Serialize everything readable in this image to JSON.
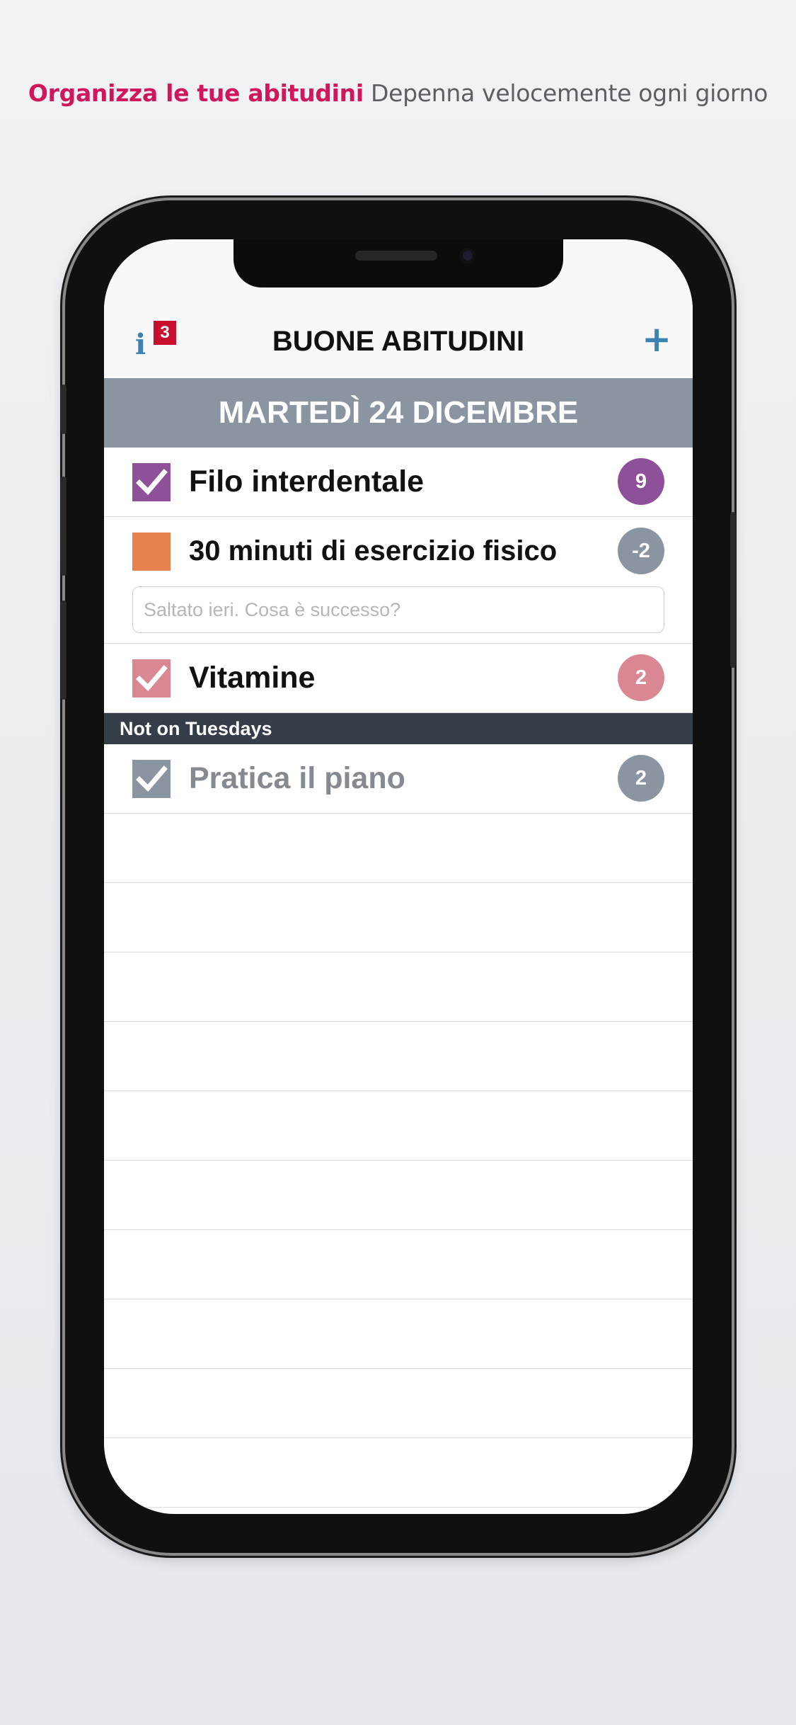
{
  "headline": {
    "accent": "Organizza le tue abitudini",
    "rest": "Depenna velocemente ogni giorno"
  },
  "navbar": {
    "info_icon": "i",
    "badge_count": "3",
    "title": "BUONE ABITUDINI",
    "add_icon": "+"
  },
  "date_header": "MARTEDÌ 24 DICEMBRE",
  "habits": [
    {
      "label": "Filo interdentale",
      "checked": true,
      "color": "#8e5199",
      "count": "9",
      "count_color": "#8e5199"
    },
    {
      "label": "30 minuti di esercizio fisico",
      "checked": false,
      "color": "#e6824e",
      "count": "-2",
      "count_color": "#8b95a1",
      "note_placeholder": "Saltato ieri. Cosa è successo?"
    },
    {
      "label": "Vitamine",
      "checked": true,
      "color": "#d98793",
      "count": "2",
      "count_color": "#d98793"
    }
  ],
  "section": {
    "title": "Not on Tuesdays",
    "habits": [
      {
        "label": "Pratica il piano",
        "checked": true,
        "color": "#8b95a1",
        "count": "2",
        "count_color": "#8b95a1"
      }
    ]
  },
  "colors": {
    "accent": "#d0175e",
    "link_blue": "#3b83b3",
    "date_band": "#8b95a1",
    "section_band": "#343d48",
    "badge_red": "#c8102e"
  }
}
